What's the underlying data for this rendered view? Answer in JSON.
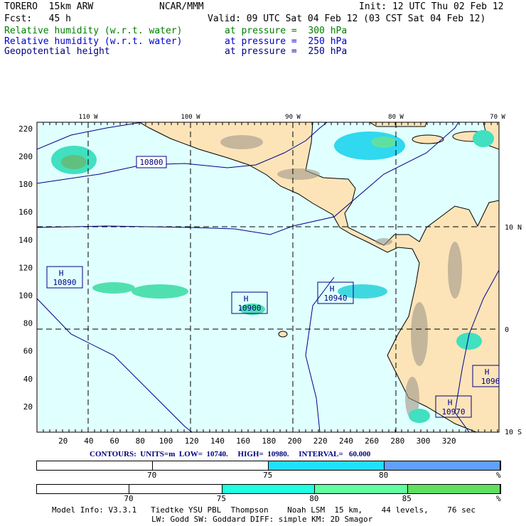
{
  "header": {
    "model": "TORERO  15km ARW",
    "org": "NCAR/MMM",
    "init": "Init: 12 UTC Thu 02 Feb 12",
    "fcst": "Fcst:   45 h",
    "valid": "Valid: 09 UTC Sat 04 Feb 12 (03 CST Sat 04 Feb 12)"
  },
  "fields": [
    {
      "name": "Relative humidity (w.r.t. water)",
      "level": "at pressure =  300 hPa",
      "color": "#008000"
    },
    {
      "name": "Relative humidity (w.r.t. water)",
      "level": "at pressure =  250 hPa",
      "color": "#0000cc"
    },
    {
      "name": "Geopotential height",
      "level": "at pressure =  250 hPa",
      "color": "#000080"
    }
  ],
  "chart_data": {
    "type": "map",
    "x_ticks": [
      "20",
      "40",
      "60",
      "80",
      "100",
      "120",
      "140",
      "160",
      "180",
      "200",
      "220",
      "240",
      "260",
      "280",
      "300",
      "320"
    ],
    "y_ticks": [
      "20",
      "40",
      "60",
      "80",
      "100",
      "120",
      "140",
      "160",
      "180",
      "200",
      "220"
    ],
    "lon_labels": [
      "110 W",
      "100 W",
      "90 W",
      "80 W",
      "70 W"
    ],
    "lat_labels": [
      "10 N",
      "0",
      "10 S"
    ],
    "contour_labels": [
      "10800"
    ],
    "highs": [
      {
        "label": "H",
        "value": "10890"
      },
      {
        "label": "H",
        "value": "10900"
      },
      {
        "label": "H",
        "value": "10940"
      },
      {
        "label": "H",
        "value": "10970"
      },
      {
        "label": "H",
        "value": "1096"
      }
    ]
  },
  "contours": "CONTOURS:  UNITS=m  LOW=  10740.     HIGH=  10980.     INTERVAL=   60.000",
  "bar1": {
    "labels": [
      "70",
      "75",
      "80",
      "%"
    ],
    "colors": [
      "#ffffff",
      "#ffffff",
      "#20e0ff",
      "#60a0ff"
    ]
  },
  "bar2": {
    "labels": [
      "70",
      "75",
      "80",
      "85",
      "%"
    ],
    "colors": [
      "#ffffff",
      "#ffffff",
      "#20ffe0",
      "#60ffa0",
      "#60e060"
    ]
  },
  "footer": {
    "line1": "Model Info: V3.3.1   Tiedtke YSU PBL  Thompson    Noah LSM  15 km,    44 levels,    76 sec",
    "line2": "LW: Godd SW: Goddard DIFF: simple KM: 2D Smagor"
  }
}
